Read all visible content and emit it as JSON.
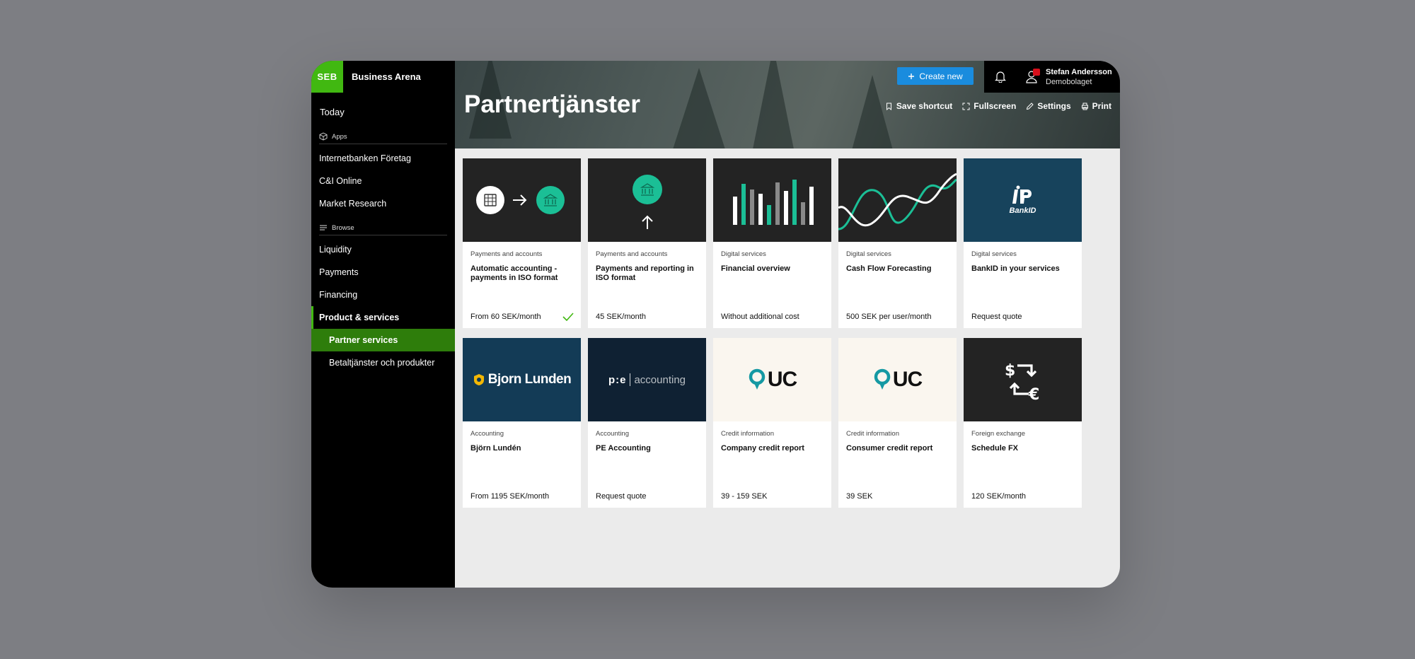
{
  "sidebar": {
    "brand_logo": "SEB",
    "brand_name": "Business Arena",
    "today": "Today",
    "apps_label": "Apps",
    "apps": [
      "Internetbanken Företag",
      "C&I Online",
      "Market Research"
    ],
    "browse_label": "Browse",
    "browse": [
      "Liquidity",
      "Payments",
      "Financing"
    ],
    "active_parent": "Product & services",
    "sub_items": [
      "Partner services",
      "Betaltjänster och produkter"
    ]
  },
  "header": {
    "title": "Partnertjänster",
    "create_label": "Create new",
    "user_name": "Stefan Andersson",
    "user_company": "Demobolaget",
    "actions": {
      "save_shortcut": "Save shortcut",
      "fullscreen": "Fullscreen",
      "settings": "Settings",
      "print": "Print"
    }
  },
  "logos": {
    "bankid": "BankID",
    "bjorn": "Bjorn Lunden",
    "pe_bold": "p:e",
    "pe_light": "accounting",
    "uc": "UC"
  },
  "cards": [
    {
      "category": "Payments and accounts",
      "title": "Automatic accounting - payments in ISO format",
      "price": "From 60 SEK/month",
      "subscribed": true
    },
    {
      "category": "Payments and accounts",
      "title": "Payments and reporting in ISO format",
      "price": "45 SEK/month"
    },
    {
      "category": "Digital services",
      "title": "Financial overview",
      "price": "Without additional cost"
    },
    {
      "category": "Digital services",
      "title": "Cash Flow Forecasting",
      "price": "500 SEK per user/month"
    },
    {
      "category": "Digital services",
      "title": "BankID in your services",
      "price": "Request quote"
    },
    {
      "category": "Accounting",
      "title": "Björn Lundén",
      "price": "From 1195 SEK/month"
    },
    {
      "category": "Accounting",
      "title": "PE Accounting",
      "price": "Request quote"
    },
    {
      "category": "Credit information",
      "title": "Company credit report",
      "price": "39 - 159 SEK"
    },
    {
      "category": "Credit information",
      "title": "Consumer credit report",
      "price": "39 SEK"
    },
    {
      "category": "Foreign exchange",
      "title": "Schedule FX",
      "price": "120 SEK/month"
    }
  ],
  "colors": {
    "brand_green": "#41b811",
    "active_green": "#2e7d0b",
    "create_blue": "#1a8cde",
    "teal": "#1bbf96",
    "notification_red": "#d60f1b"
  }
}
